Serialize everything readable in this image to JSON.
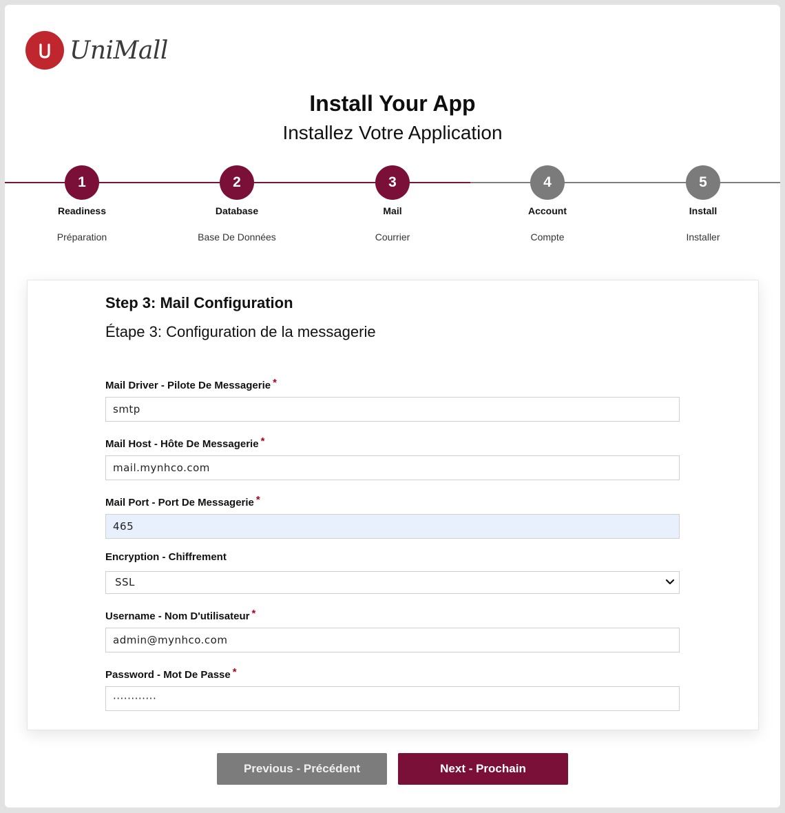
{
  "brand": {
    "name": "UniMall",
    "logo_letter": "U",
    "color": "#c0262d"
  },
  "header": {
    "title": "Install Your App",
    "subtitle": "Installez Votre Application"
  },
  "colors": {
    "accent": "#7a1038",
    "inactive": "#7b7b7b",
    "autofill": "#e8f0fe"
  },
  "steps": [
    {
      "number": "1",
      "label": "Readiness",
      "sub": "Préparation",
      "state": "done"
    },
    {
      "number": "2",
      "label": "Database",
      "sub": "Base De Données",
      "state": "done"
    },
    {
      "number": "3",
      "label": "Mail",
      "sub": "Courrier",
      "state": "current"
    },
    {
      "number": "4",
      "label": "Account",
      "sub": "Compte",
      "state": "todo"
    },
    {
      "number": "5",
      "label": "Install",
      "sub": "Installer",
      "state": "todo"
    }
  ],
  "card": {
    "title": "Step 3: Mail Configuration",
    "subtitle": "Étape 3: Configuration de la messagerie"
  },
  "form": {
    "driver": {
      "label": "Mail Driver - Pilote De Messagerie",
      "required": "*",
      "value": "smtp"
    },
    "host": {
      "label": "Mail Host - Hôte De Messagerie",
      "required": "*",
      "value": "mail.mynhco.com"
    },
    "port": {
      "label": "Mail Port - Port De Messagerie",
      "required": "*",
      "value": "465"
    },
    "encryption": {
      "label": "Encryption - Chiffrement",
      "value": "SSL"
    },
    "username": {
      "label": "Username - Nom D'utilisateur",
      "required": "*",
      "value": "admin@mynhco.com"
    },
    "password": {
      "label": "Password - Mot De Passe",
      "required": "*",
      "value": "············"
    }
  },
  "buttons": {
    "previous": "Previous - Précédent",
    "next": "Next - Prochain"
  }
}
